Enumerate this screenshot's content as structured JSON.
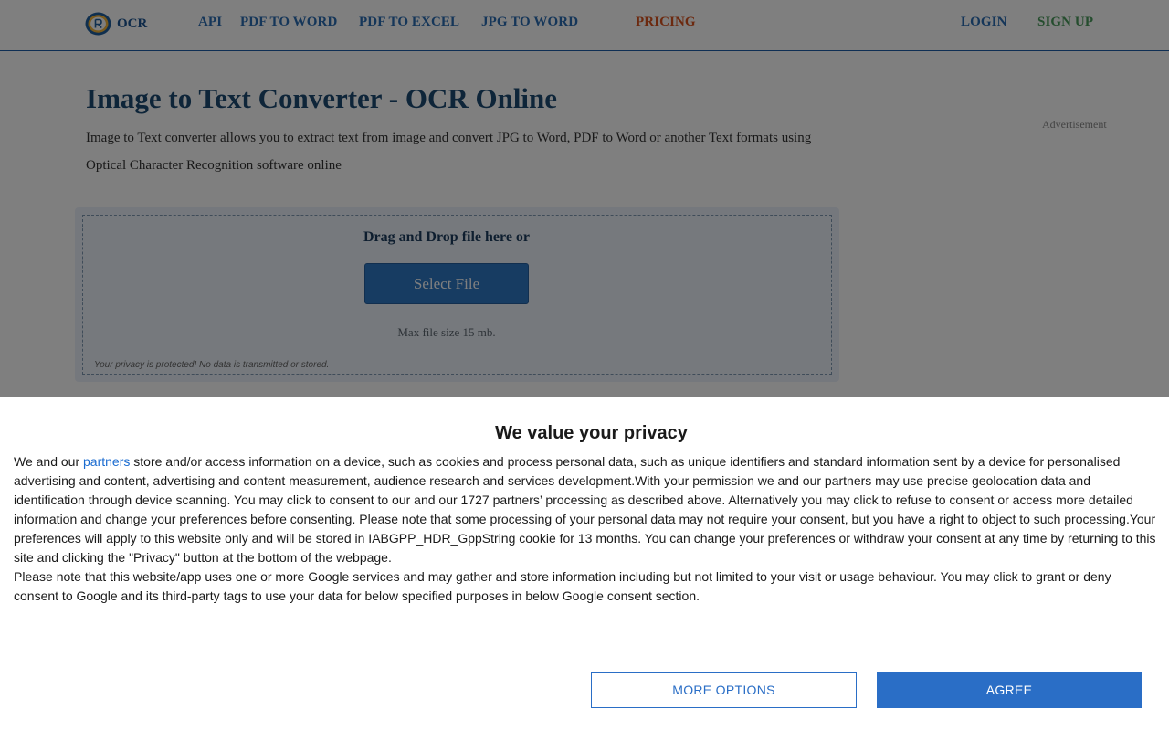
{
  "header": {
    "logo_text": "OCR",
    "nav": {
      "api": "API",
      "pdf_to_word": "PDF TO WORD",
      "pdf_to_excel": "PDF TO EXCEL",
      "jpg_to_word": "JPG TO WORD",
      "pricing": "PRICING",
      "login": "LOGIN",
      "signup": "SIGN UP"
    },
    "colors": {
      "nav": "#2b6cb3",
      "pricing": "#d9531e",
      "signup": "#4a9a5d"
    }
  },
  "main": {
    "title": "Image to Text Converter - OCR Online",
    "description": "Image to Text converter allows you to extract text from image and convert JPG to Word, PDF to Word or another Text formats using Optical Character Recognition software online",
    "advertisement_label": "Advertisement",
    "upload": {
      "prompt": "Drag and Drop file here or",
      "button_label": "Select File",
      "max_size": "Max file size 15 mb.",
      "privacy_note": "Your privacy is protected! No data is transmitted or stored."
    }
  },
  "consent": {
    "title": "We value your privacy",
    "body_prefix": "We and our ",
    "partners_link": "partners",
    "body_main": " store and/or access information on a device, such as cookies and process personal data, such as unique identifiers and standard information sent by a device for personalised advertising and content, advertising and content measurement, audience research and services development.With your permission we and our partners may use precise geolocation data and identification through device scanning. You may click to consent to our and our 1727 partners’ processing as described above. Alternatively you may click to refuse to consent or access more detailed information and change your preferences before consenting. Please note that some processing of your personal data may not require your consent, but you have a right to object to such processing.Your preferences will apply to this website only and will be stored in IABGPP_HDR_GppString cookie for 13 months. You can change your preferences or withdraw your consent at any time by returning to this site and clicking the \"Privacy\" button at the bottom of the webpage.",
    "body_google": "Please note that this website/app uses one or more Google services and may gather and store information including but not limited to your visit or usage behaviour. You may click to grant or deny consent to Google and its third-party tags to use your data for below specified purposes in below Google consent section.",
    "more_options_label": "MORE OPTIONS",
    "agree_label": "AGREE",
    "colors": {
      "accent": "#2a6ec6"
    }
  }
}
